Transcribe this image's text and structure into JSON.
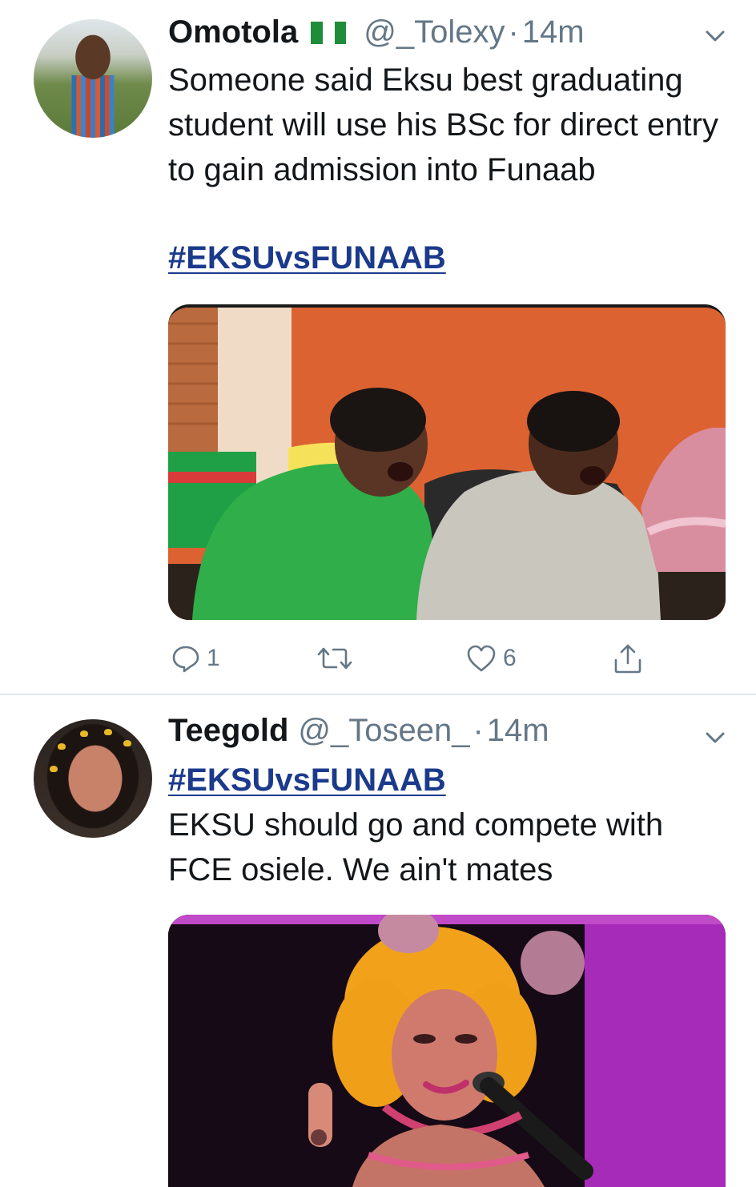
{
  "tweets": [
    {
      "name": "Omotola",
      "handle": "@_Tolexy",
      "separator": "·",
      "time": "14m",
      "text": "Someone said Eksu best graduating student will use his BSc for direct entry to gain admission into Funaab",
      "hashtag": "#EKSUvsFUNAAB",
      "flag_colors": [
        "#1e8c3a",
        "#ffffff",
        "#1e8c3a"
      ],
      "avatar_icon": "avatar",
      "media_icon": "gif-media",
      "actions": {
        "reply_count": "1",
        "retweet_count": "",
        "like_count": "6"
      }
    },
    {
      "name": "Teegold",
      "handle": "@_Toseen_",
      "separator": "·",
      "time": "14m",
      "hashtag": "#EKSUvsFUNAAB",
      "text": "EKSU should go and compete with FCE osiele. We ain't mates",
      "avatar_icon": "avatar",
      "media_icon": "gif-media"
    }
  ],
  "colors": {
    "link": "#1b3a8c",
    "secondary_text": "#657786",
    "divider": "#e1e8ed"
  }
}
